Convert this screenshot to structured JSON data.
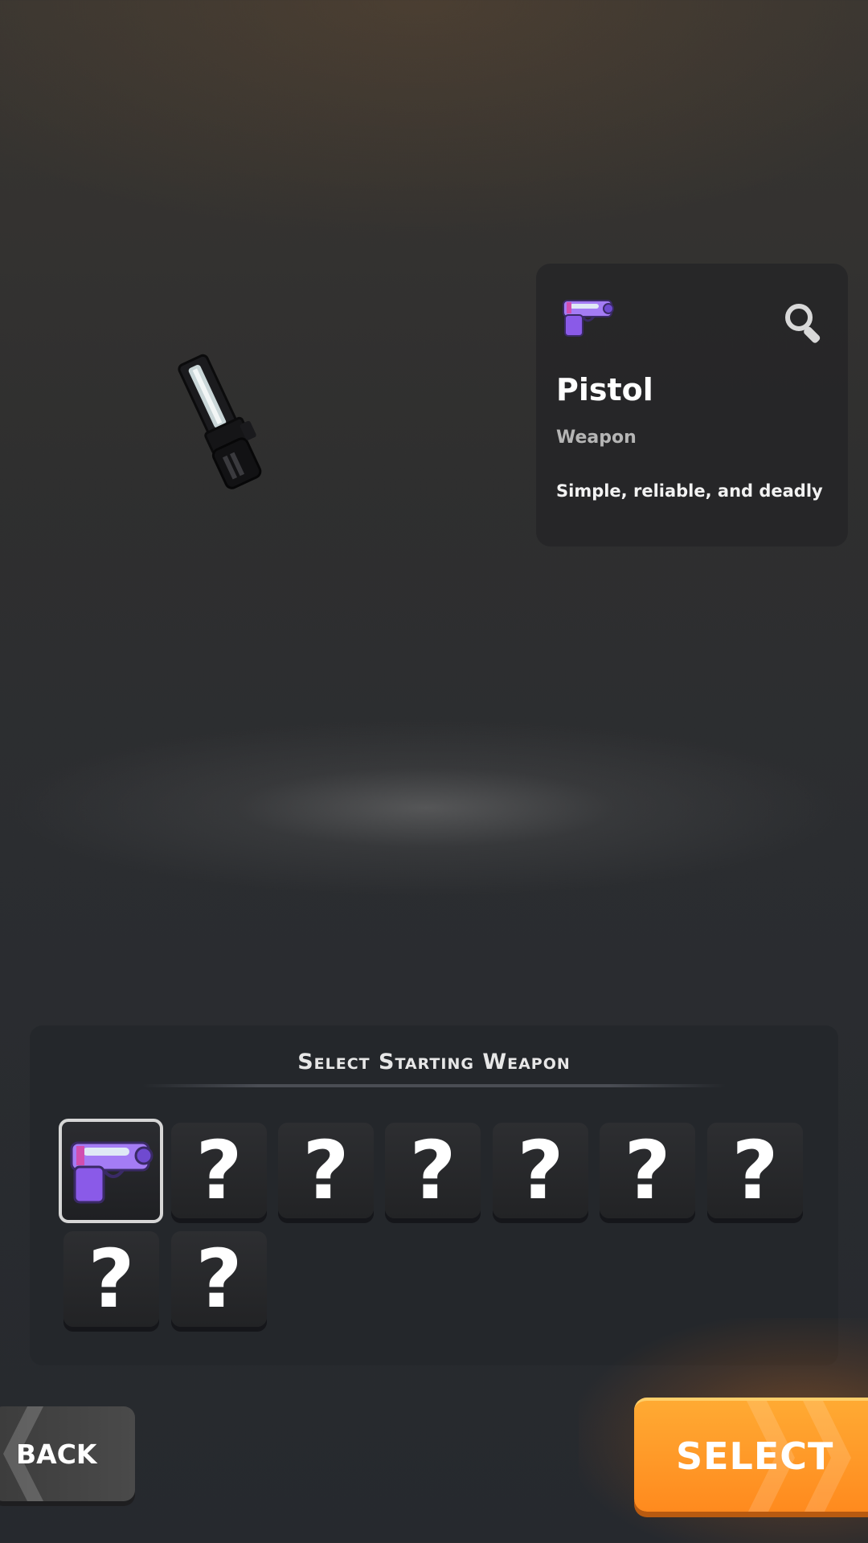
{
  "preview": {
    "model_icon": "pistol-3d-model"
  },
  "info_card": {
    "icon": "purple-pistol-icon",
    "inspect_icon": "magnifier-icon",
    "title": "Pistol",
    "subtitle": "Weapon",
    "description": "Simple, reliable, and deadly"
  },
  "selection": {
    "title": "Select Starting Weapon",
    "slots": [
      {
        "state": "selected",
        "icon": "purple-pistol-icon",
        "label": ""
      },
      {
        "state": "locked",
        "label": "?"
      },
      {
        "state": "locked",
        "label": "?"
      },
      {
        "state": "locked",
        "label": "?"
      },
      {
        "state": "locked",
        "label": "?"
      },
      {
        "state": "locked",
        "label": "?"
      },
      {
        "state": "locked",
        "label": "?"
      },
      {
        "state": "locked",
        "label": "?"
      },
      {
        "state": "locked",
        "label": "?"
      }
    ]
  },
  "buttons": {
    "back_label": "BACK",
    "select_label": "SELECT"
  },
  "colors": {
    "accent_orange": "#ff9a2a",
    "weapon_purple": "#9b6bf0",
    "panel_bg": "#24272b"
  }
}
